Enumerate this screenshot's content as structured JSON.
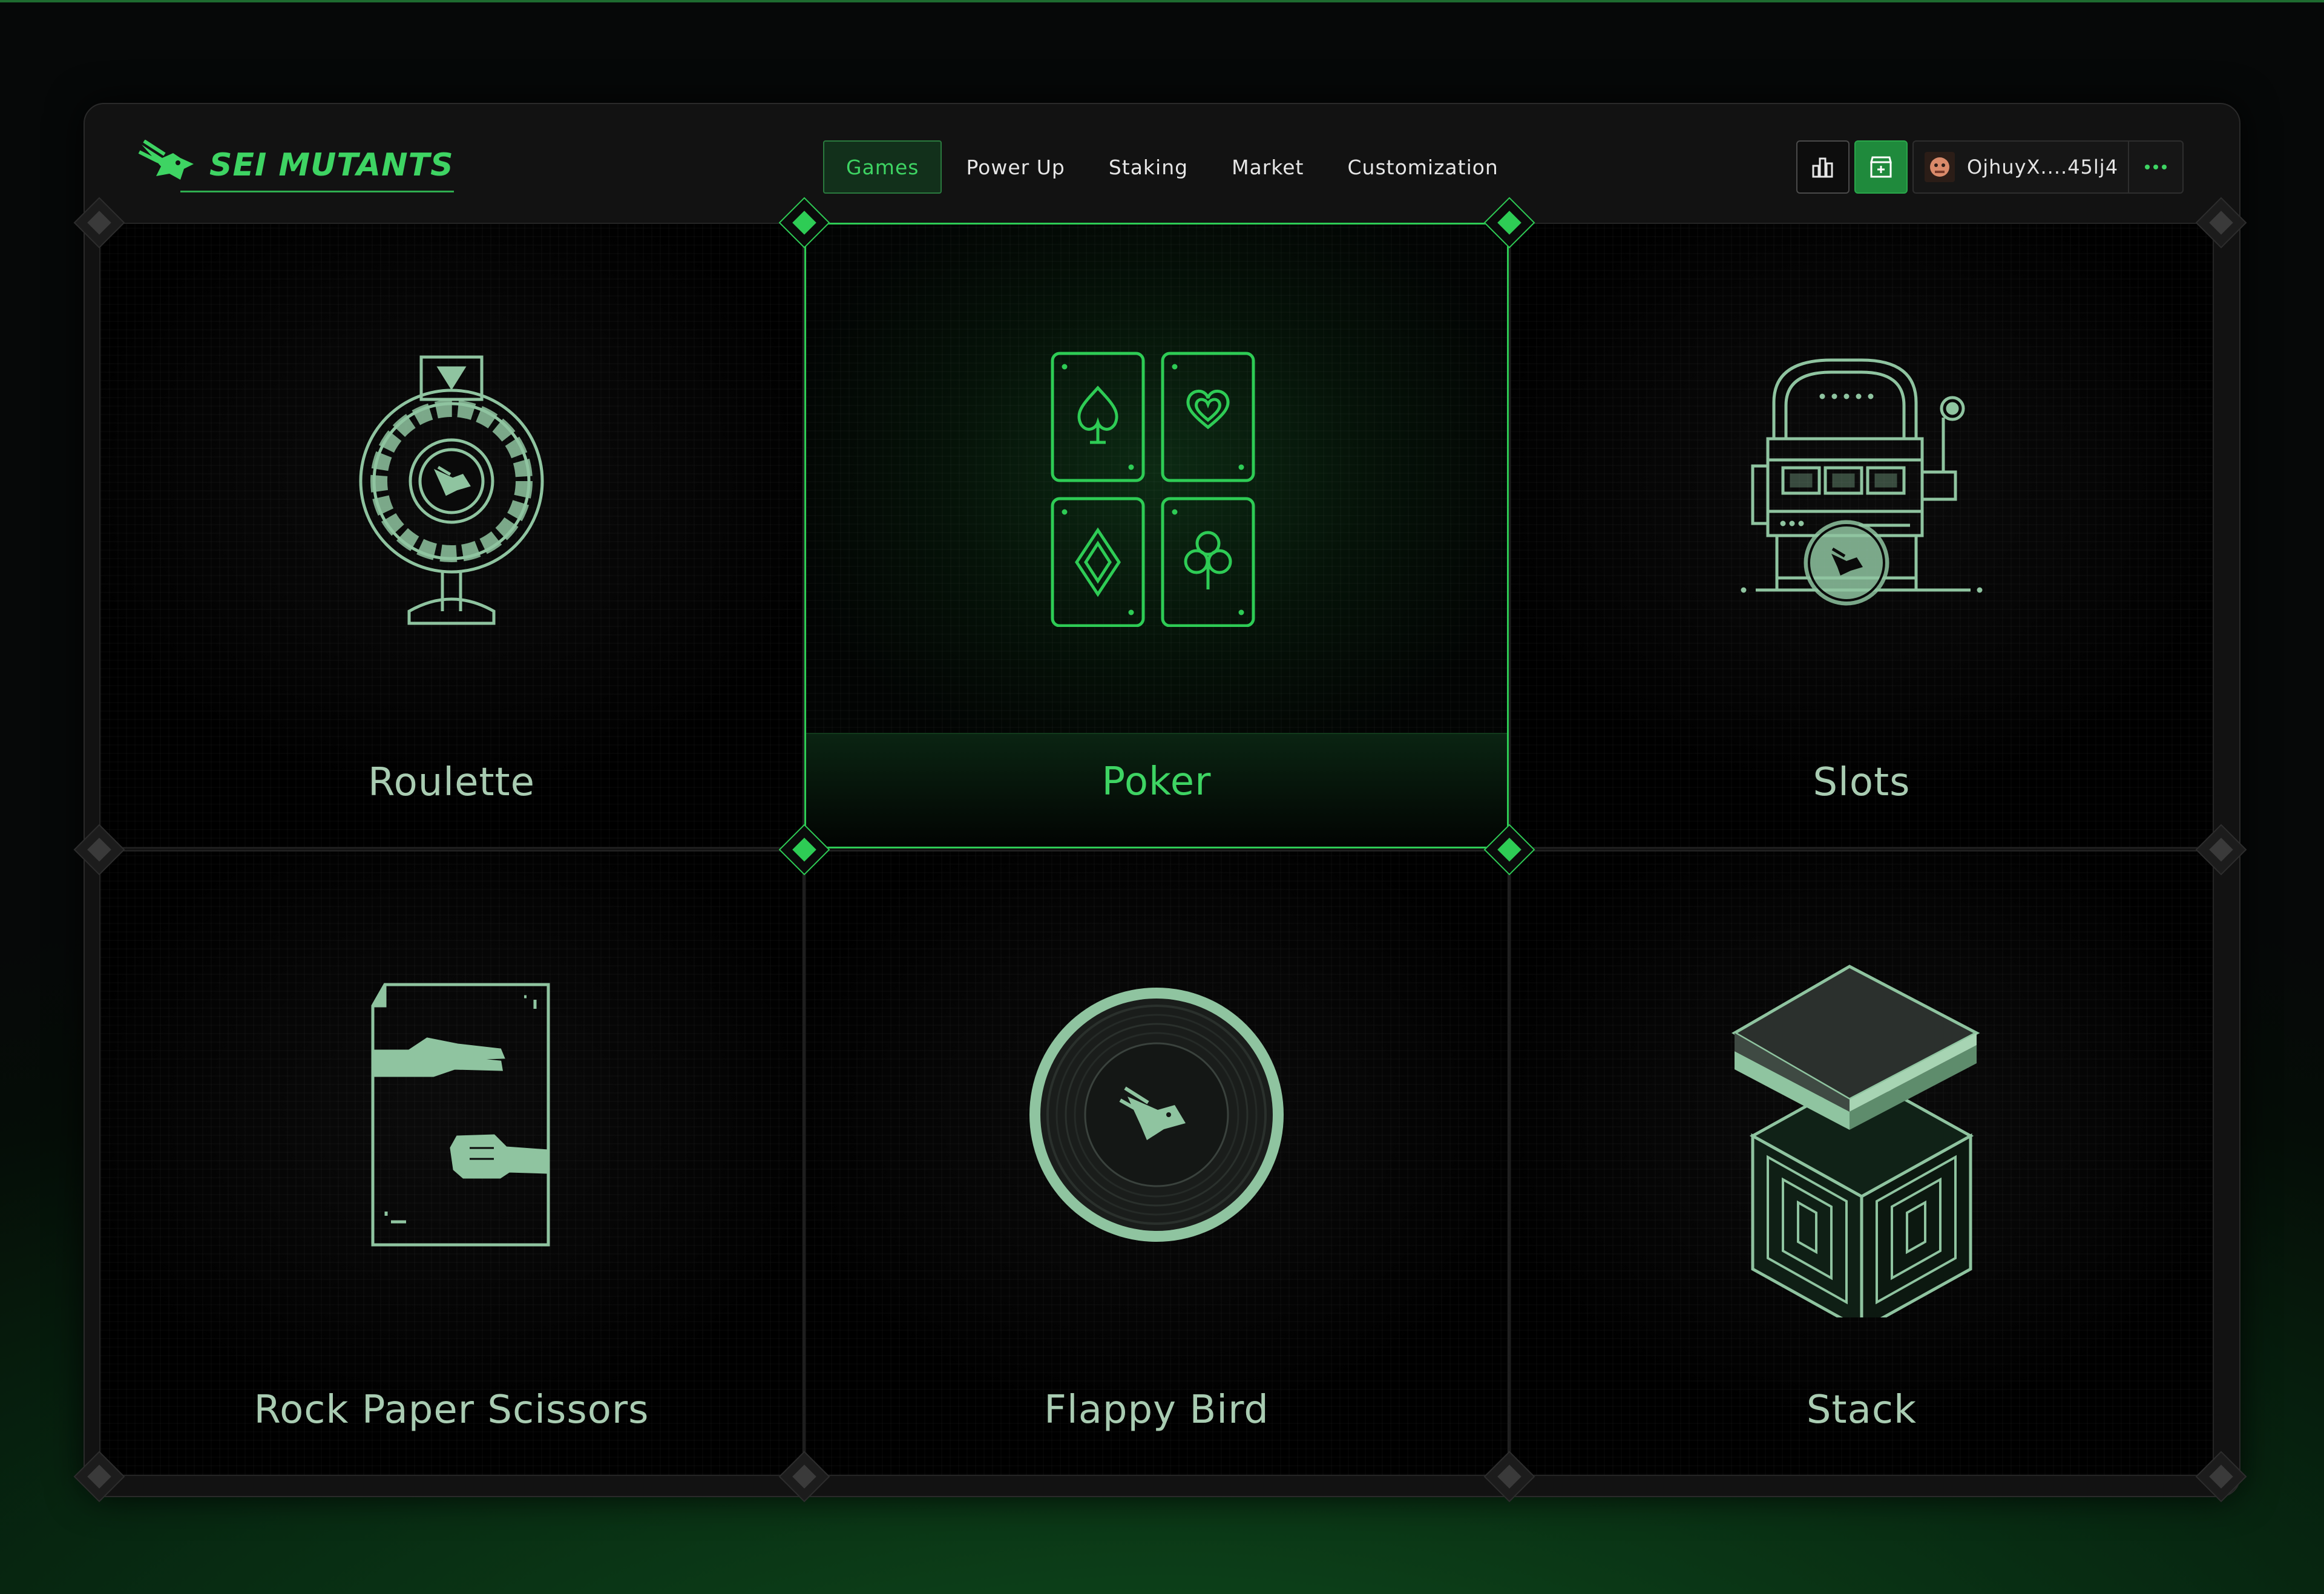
{
  "brand": {
    "name": "SEI MUTANTS"
  },
  "nav": {
    "items": [
      {
        "label": "Games",
        "active": true
      },
      {
        "label": "Power Up",
        "active": false
      },
      {
        "label": "Staking",
        "active": false
      },
      {
        "label": "Market",
        "active": false
      },
      {
        "label": "Customization",
        "active": false
      }
    ]
  },
  "header_actions": {
    "leaderboard_icon": "bar-chart-icon",
    "store_icon": "store-icon",
    "wallet_address": "OjhuyX....45lj4",
    "wallet_avatar_icon": "avatar",
    "more_icon": "more-dots-icon"
  },
  "games": [
    {
      "label": "Roulette",
      "icon": "roulette-icon",
      "selected": false
    },
    {
      "label": "Poker",
      "icon": "cards-icon",
      "selected": true
    },
    {
      "label": "Slots",
      "icon": "slot-machine-icon",
      "selected": false
    },
    {
      "label": "Rock Paper Scissors",
      "icon": "hand-gesture-icon",
      "selected": false
    },
    {
      "label": "Flappy Bird",
      "icon": "coin-icon",
      "selected": false
    },
    {
      "label": "Stack",
      "icon": "stack-box-icon",
      "selected": false
    }
  ],
  "colors": {
    "accent": "#3ed463",
    "icon_mint": "#8fc4a0",
    "background": "#050505"
  }
}
